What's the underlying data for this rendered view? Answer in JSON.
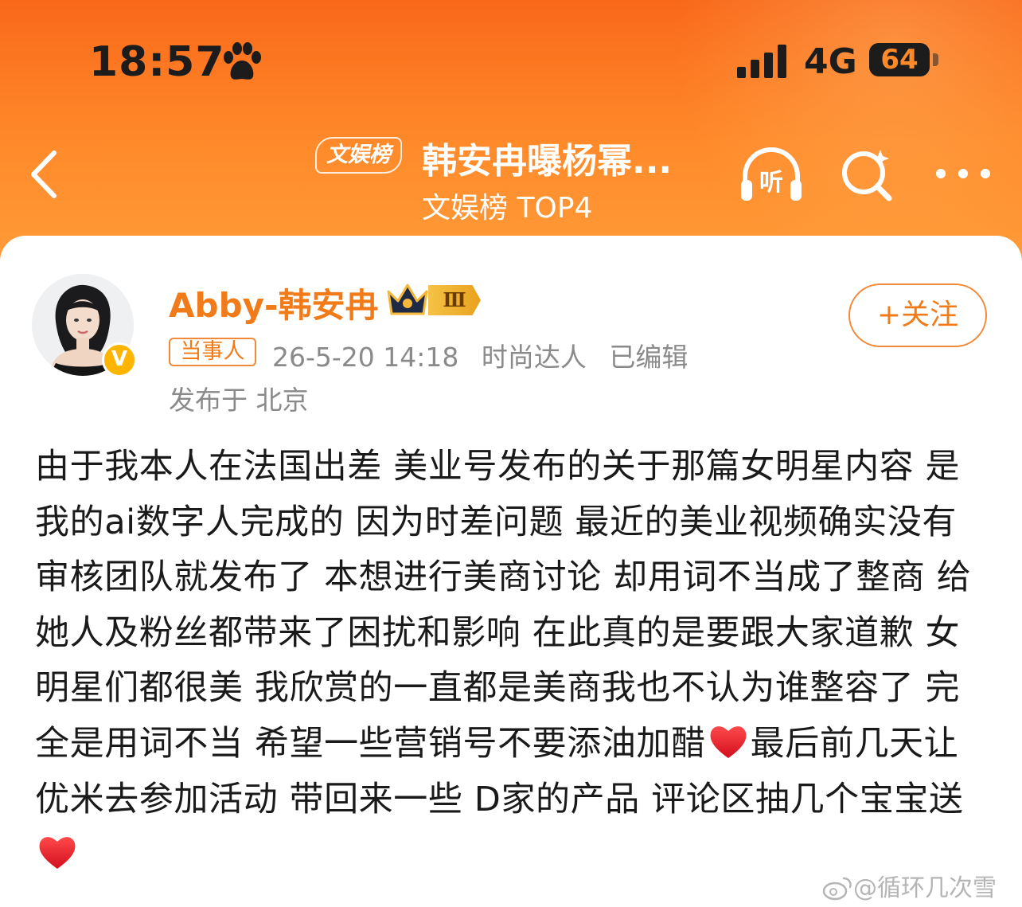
{
  "status_bar": {
    "time": "18:57",
    "network": "4G",
    "battery": "64"
  },
  "header": {
    "chip_label": "文娱榜",
    "title": "韩安冉曝杨幂...",
    "subtitle": "文娱榜 TOP4"
  },
  "post": {
    "author": {
      "name": "Abby-韩安冉",
      "level": "Ⅲ",
      "verified_mark": "V"
    },
    "follow_label": "+关注",
    "tag": "当事人",
    "meta": {
      "datetime": "26-5-20 14:18",
      "category": "时尚达人",
      "edited": "已编辑"
    },
    "location": "发布于 北京",
    "content": {
      "part1": "由于我本人在法国出差 美业号发布的关于那篇女明星内容 是我的ai数字人完成的 因为时差问题 最近的美业视频确实没有审核团队就发布了 本想进行美商讨论 却用词不当成了整商 给她人及粉丝都带来了困扰和影响 在此真的是要跟大家道歉 女明星们都很美 我欣赏的一直都是美商我也不认为谁整容了 完全是用词不当 希望一些营销号不要添油加醋",
      "part2": "最后前几天让优米去参加活动 带回来一些 D家的产品 评论区抽几个宝宝送"
    }
  },
  "watermark": "@循环几次雪",
  "colors": {
    "header_orange": "#f9681a",
    "accent": "#f07b18",
    "heart": "#e8192c"
  }
}
